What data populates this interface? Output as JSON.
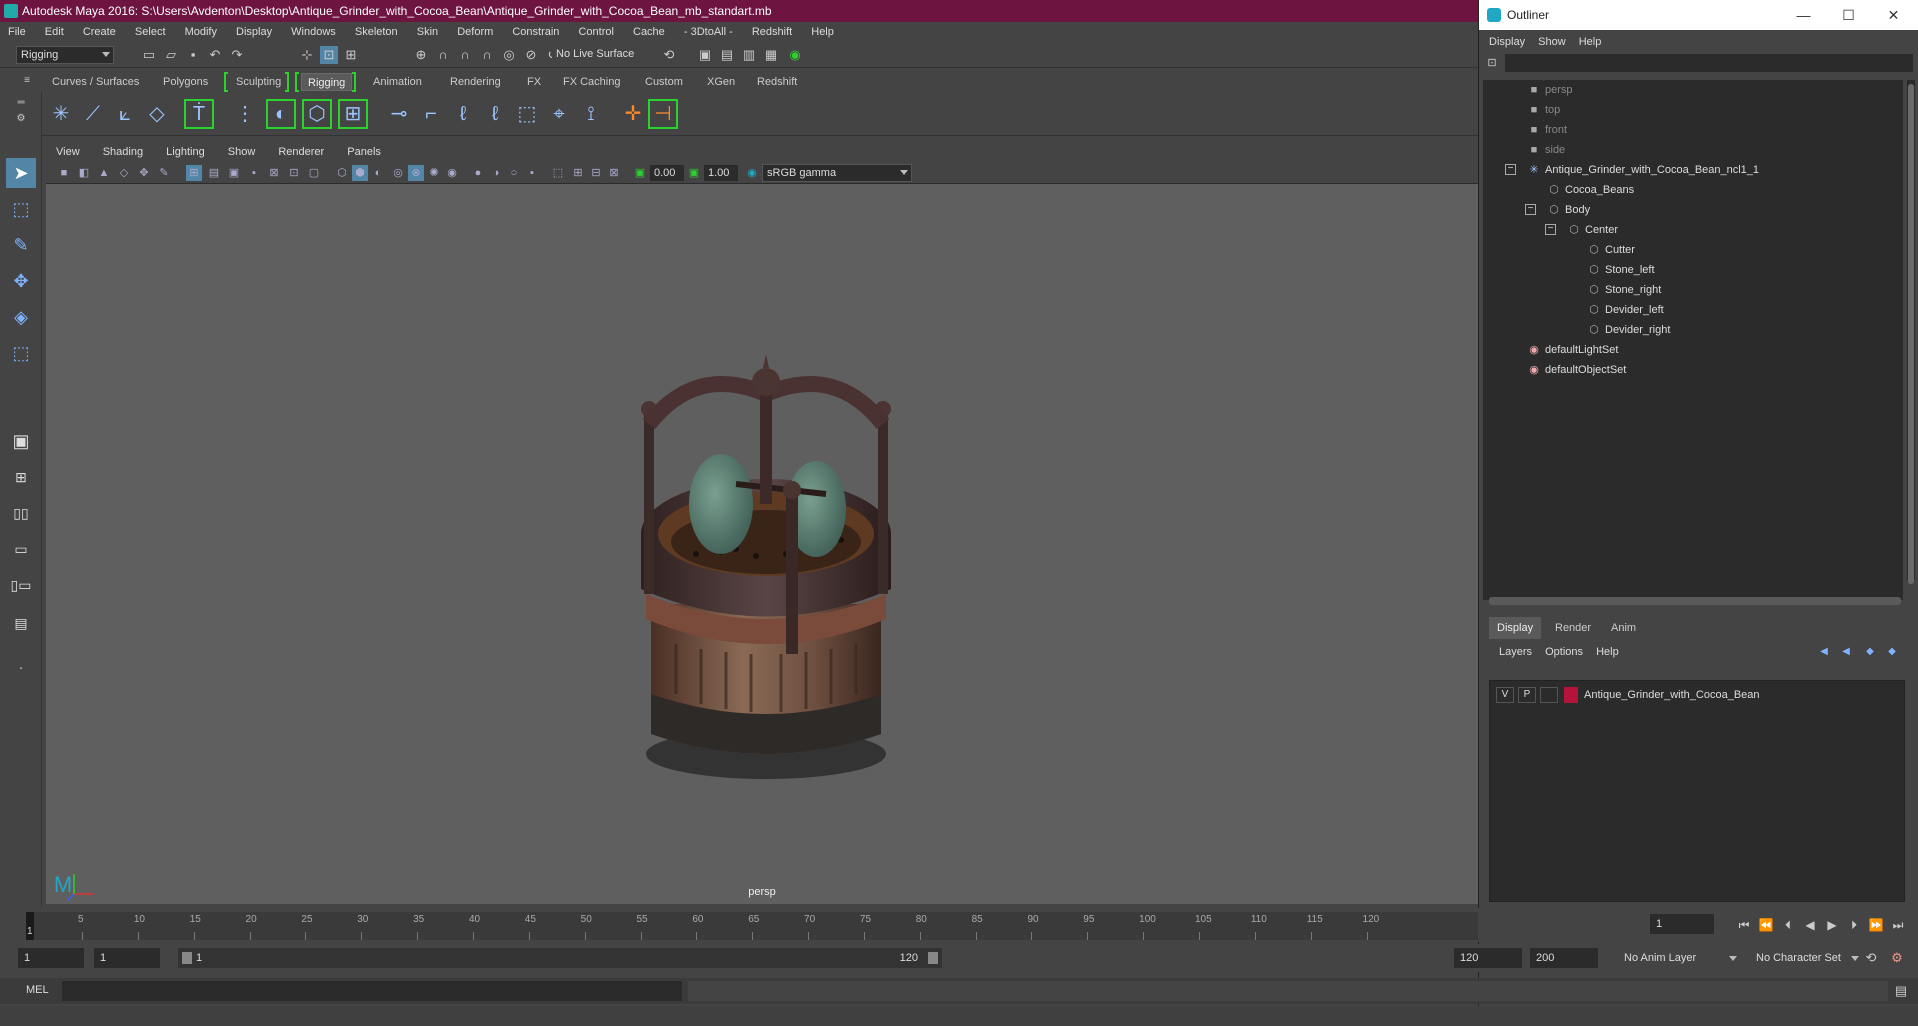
{
  "window": {
    "title": "Autodesk Maya 2016: S:\\Users\\Avdenton\\Desktop\\Antique_Grinder_with_Cocoa_Bean\\Antique_Grinder_with_Cocoa_Bean_mb_standart.mb"
  },
  "menubar": [
    "File",
    "Edit",
    "Create",
    "Select",
    "Modify",
    "Display",
    "Windows",
    "Skeleton",
    "Skin",
    "Deform",
    "Constrain",
    "Control",
    "Cache",
    "- 3DtoAll -",
    "Redshift",
    "Help"
  ],
  "statusline": {
    "menuset": "Rigging",
    "live_surface": "No Live Surface"
  },
  "shelf": {
    "tabs": [
      "Curves / Surfaces",
      "Polygons",
      "Sculpting",
      "Rigging",
      "Animation",
      "Rendering",
      "FX",
      "FX Caching",
      "Custom",
      "XGen",
      "Redshift"
    ],
    "active_tab": "Rigging"
  },
  "viewport": {
    "menu": [
      "View",
      "Shading",
      "Lighting",
      "Show",
      "Renderer",
      "Panels"
    ],
    "exposure": "0.00",
    "gamma": "1.00",
    "colorspace": "sRGB gamma",
    "camera_label": "persp"
  },
  "outliner": {
    "title": "Outliner",
    "menu": [
      "Display",
      "Show",
      "Help"
    ],
    "cameras": [
      "persp",
      "top",
      "front",
      "side"
    ],
    "root": "Antique_Grinder_with_Cocoa_Bean_ncl1_1",
    "children": {
      "cocoa": "Cocoa_Beans",
      "body": "Body",
      "center": "Center",
      "parts": [
        "Cutter",
        "Stone_left",
        "Stone_right",
        "Devider_left",
        "Devider_right"
      ]
    },
    "sets": [
      "defaultLightSet",
      "defaultObjectSet"
    ]
  },
  "layer_editor": {
    "tabs": [
      "Display",
      "Render",
      "Anim"
    ],
    "active_tab": "Display",
    "menu": [
      "Layers",
      "Options",
      "Help"
    ],
    "layer": {
      "v": "V",
      "p": "P",
      "name": "Antique_Grinder_with_Cocoa_Bean",
      "color": "#b4133a"
    }
  },
  "timeline": {
    "ticks": [
      "5",
      "10",
      "15",
      "20",
      "25",
      "30",
      "35",
      "40",
      "45",
      "50",
      "55",
      "60",
      "65",
      "70",
      "75",
      "80",
      "85",
      "90",
      "95",
      "100",
      "105",
      "110",
      "115",
      "120"
    ],
    "current_frame": "1",
    "current_field": "1"
  },
  "range": {
    "start": "1",
    "inner_start": "1",
    "slider_start": "1",
    "slider_end": "120",
    "end": "120",
    "anim_end": "200",
    "anim_layer": "No Anim Layer",
    "char_set": "No Character Set"
  },
  "cmdline": {
    "label": "MEL"
  }
}
